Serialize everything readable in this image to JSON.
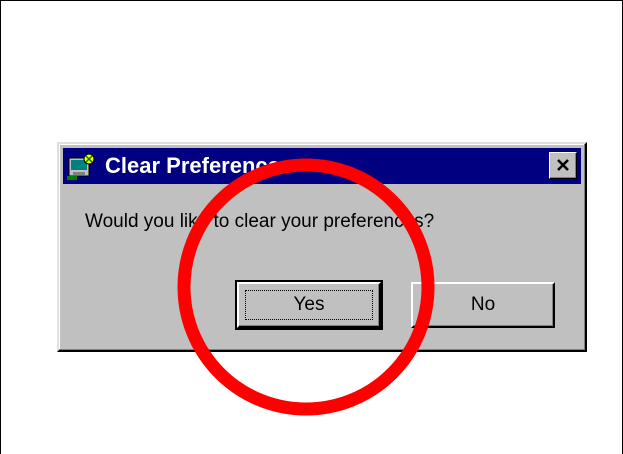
{
  "dialog": {
    "title": "Clear Preferences",
    "title_icon": "application-icon",
    "close_icon": "close-icon",
    "message": "Would you like to clear your preferences?",
    "buttons": {
      "yes_label": "Yes",
      "no_label": "No"
    },
    "default_button": "Yes"
  },
  "annotation": {
    "shape": "circle",
    "color": "#ff0000",
    "target": "Yes"
  },
  "colors": {
    "titlebar": "#000080",
    "dialog_face": "#c0c0c0",
    "annotation": "#ff0000"
  }
}
